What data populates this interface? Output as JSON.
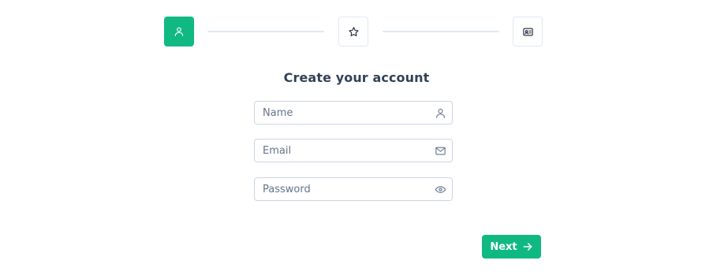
{
  "stepper": {
    "steps": [
      {
        "icon": "user-icon",
        "state": "active"
      },
      {
        "icon": "star-icon",
        "state": "inactive"
      },
      {
        "icon": "id-card-icon",
        "state": "inactive"
      }
    ]
  },
  "form": {
    "title": "Create your account",
    "fields": {
      "name": {
        "placeholder": "Name",
        "icon": "user-icon"
      },
      "email": {
        "placeholder": "Email",
        "icon": "mail-icon"
      },
      "password": {
        "placeholder": "Password",
        "icon": "eye-icon"
      }
    }
  },
  "actions": {
    "next_label": "Next",
    "next_icon": "arrow-right-icon"
  },
  "colors": {
    "accent": "#10b981",
    "border": "#cbd5e1",
    "connector": "#e2e8f0",
    "text": "#334155",
    "placeholder": "#64748b"
  }
}
